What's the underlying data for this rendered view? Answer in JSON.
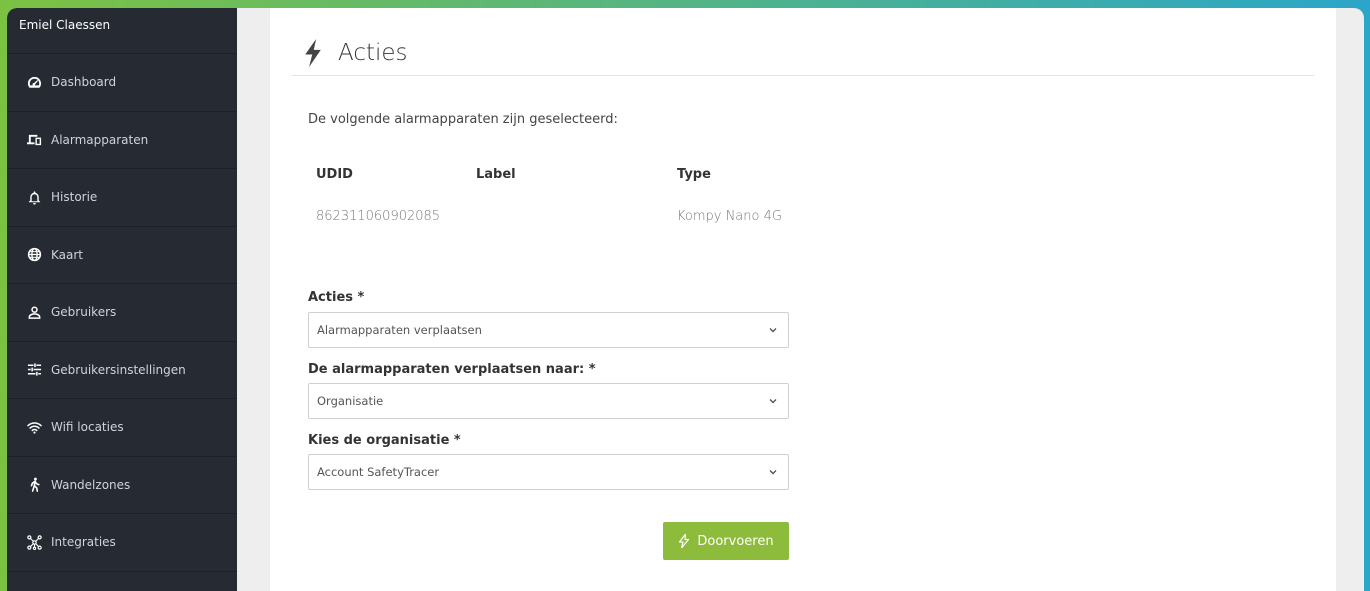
{
  "sidebar": {
    "user_name": "Emiel Claessen",
    "items": [
      {
        "label": "Dashboard",
        "icon": "dashboard-icon"
      },
      {
        "label": "Alarmapparaten",
        "icon": "devices-icon"
      },
      {
        "label": "Historie",
        "icon": "bell-icon"
      },
      {
        "label": "Kaart",
        "icon": "globe-icon"
      },
      {
        "label": "Gebruikers",
        "icon": "user-icon"
      },
      {
        "label": "Gebruikersinstellingen",
        "icon": "sliders-icon"
      },
      {
        "label": "Wifi locaties",
        "icon": "wifi-icon"
      },
      {
        "label": "Wandelzones",
        "icon": "walking-icon"
      },
      {
        "label": "Integraties",
        "icon": "integrations-icon"
      }
    ]
  },
  "page": {
    "title": "Acties",
    "intro": "De volgende alarmapparaten zijn geselecteerd:"
  },
  "table": {
    "headers": [
      "UDID",
      "Label",
      "Type"
    ],
    "rows": [
      {
        "udid": "862311060902085",
        "label": "",
        "type": "Kompy Nano 4G"
      }
    ]
  },
  "form": {
    "action_label": "Acties *",
    "action_value": "Alarmapparaten verplaatsen",
    "move_label": "De alarmapparaten verplaatsen naar: *",
    "move_value": "Organisatie",
    "org_label": "Kies de organisatie *",
    "org_value": "Account SafetyTracer",
    "submit_label": "Doorvoeren"
  },
  "colors": {
    "sidebar_bg": "#262b33",
    "accent_green": "#8dbb3c",
    "frame_gradient_start": "#7cc242",
    "frame_gradient_end": "#2ba6c9"
  }
}
